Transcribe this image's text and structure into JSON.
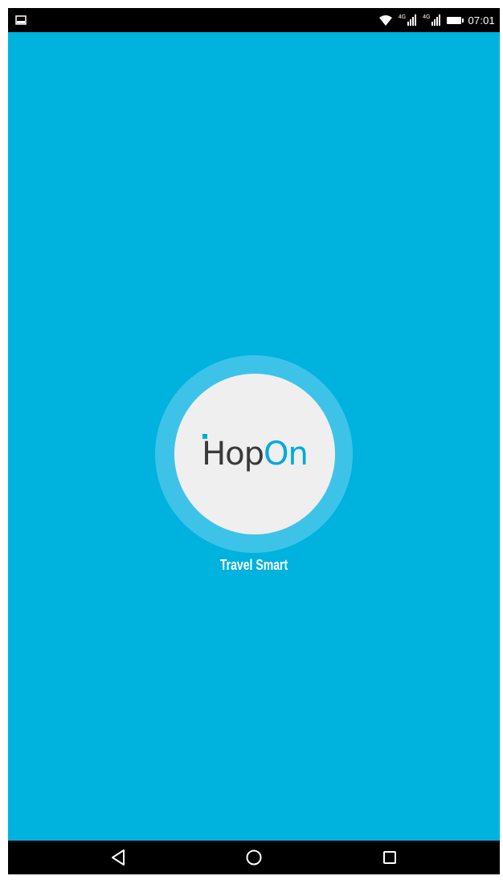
{
  "status_bar": {
    "time": "07:01",
    "notification_icon": "image-notification-icon",
    "wifi_icon": "wifi-icon",
    "signal_1_icon": "cell-signal-icon",
    "signal_2_icon": "cell-signal-icon",
    "battery_icon": "battery-icon"
  },
  "splash": {
    "background_color": "#00b2de",
    "ring_color": "#3ec3e8",
    "disc_color": "#efefef",
    "logo": {
      "part_h": "H",
      "part_op": "op",
      "part_on": "On",
      "dark_color": "#3a3a3a",
      "accent_color": "#00a9dc"
    },
    "tagline": "Travel Smart"
  },
  "nav_bar": {
    "back_icon": "back-triangle-icon",
    "home_icon": "home-circle-icon",
    "recents_icon": "recents-square-icon"
  }
}
